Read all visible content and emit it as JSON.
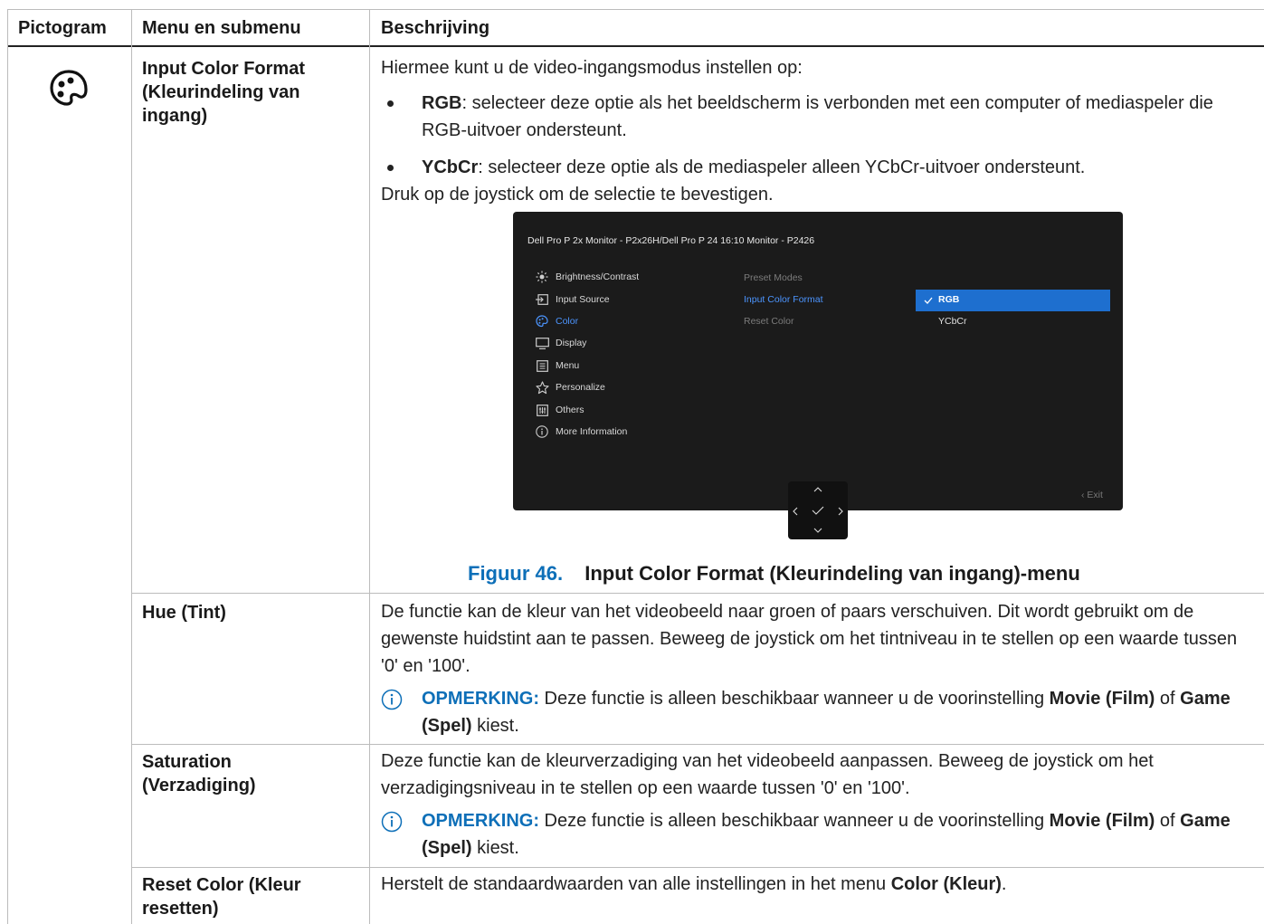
{
  "table": {
    "headers": {
      "icon": "Pictogram",
      "menu": "Menu en submenu",
      "desc": "Beschrijving"
    },
    "rows": {
      "input_color": {
        "title": "Input Color Format (Kleurindeling van ingang)",
        "intro": "Hiermee kunt u de video-ingangsmodus instellen op:",
        "bullets": [
          {
            "term": "RGB",
            "text": ": selecteer deze optie als het beeldscherm is verbonden met een computer of mediaspeler die RGB-uitvoer ondersteunt."
          },
          {
            "term": "YCbCr",
            "text": ": selecteer deze optie als de mediaspeler alleen YCbCr-uitvoer ondersteunt."
          }
        ],
        "outro": "Druk op de joystick om de selectie te bevestigen.",
        "figure_label": "Figuur 46.",
        "figure_caption": "Input Color Format (Kleurindeling van ingang)-menu"
      },
      "hue": {
        "title": "Hue (Tint)",
        "desc": "De functie kan de kleur van het videobeeld naar groen of paars verschuiven. Dit wordt gebruikt om de gewenste huidstint aan te passen. Beweeg de joystick om het tintniveau in te stellen op een waarde tussen '0' en '100'."
      },
      "saturation": {
        "title": "Saturation (Verzadiging)",
        "desc": "Deze functie kan de kleurverzadiging van het videobeeld aanpassen. Beweeg de joystick om het verzadigingsniveau in te stellen op een waarde tussen '0' en '100'."
      },
      "reset": {
        "title": "Reset Color (Kleur resetten)",
        "desc_pre": "Herstelt de standaardwaarden van alle instellingen in het menu ",
        "desc_bold": "Color (Kleur)",
        "desc_post": "."
      }
    },
    "note": {
      "label": "OPMERKING:",
      "text1": " Deze functie is alleen beschikbaar wanneer u de voorinstelling ",
      "bold1": "Movie (Film)",
      "text2": " of ",
      "bold2": "Game (Spel)",
      "text3": " kiest."
    }
  },
  "osd": {
    "title": "Dell Pro P 2x Monitor - P2x26H/Dell Pro P 24 16:10 Monitor - P2426",
    "menu": [
      "Brightness/Contrast",
      "Input Source",
      "Color",
      "Display",
      "Menu",
      "Personalize",
      "Others",
      "More Information"
    ],
    "submenu": [
      "Preset Modes",
      "Input Color Format",
      "Reset Color"
    ],
    "options": [
      "RGB",
      "YCbCr"
    ],
    "exit": "Exit"
  },
  "colors": {
    "accent": "#0d6fb8",
    "osd_selected": "#1e6fcf",
    "osd_bg": "#1b1b1b"
  }
}
